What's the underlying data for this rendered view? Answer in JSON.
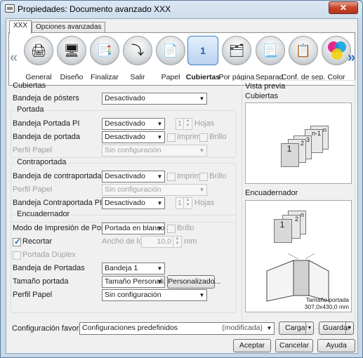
{
  "window": {
    "title": "Propiedades: Documento avanzado XXX",
    "close_label": "✕"
  },
  "tabs": [
    {
      "label": "XXX"
    },
    {
      "label": "Opciones avanzadas"
    }
  ],
  "toolbar": {
    "items": [
      {
        "label": "General",
        "icon": "printer-icon"
      },
      {
        "label": "Diseño",
        "icon": "layout-icon"
      },
      {
        "label": "Finalizar",
        "icon": "finishing-icon"
      },
      {
        "label": "Salir",
        "icon": "output-tray-icon"
      },
      {
        "label": "Papel",
        "icon": "paper-icon"
      },
      {
        "label": "Cubiertas",
        "icon": "cover-icon"
      },
      {
        "label": "Por página",
        "icon": "per-page-icon"
      },
      {
        "label": "Separad.",
        "icon": "separator-icon"
      },
      {
        "label": "Conf. de sep.",
        "icon": "separator-settings-icon"
      },
      {
        "label": "Color",
        "icon": "color-icon"
      }
    ],
    "active": "Cubiertas"
  },
  "cubiertas": {
    "section_label": "Cubiertas",
    "bandeja_posters_label": "Bandeja de pósters",
    "bandeja_posters_value": "Desactivado"
  },
  "portada": {
    "group_label": "Portada",
    "bandeja_pi_label": "Bandeja Portada PI",
    "bandeja_pi_value": "Desactivado",
    "bandeja_pi_spin": "1",
    "hojas_label": "Hojas",
    "bandeja_label": "Bandeja de portada",
    "bandeja_value": "Desactivado",
    "imprimir_label": "Imprimir",
    "brillo_label": "Brillo",
    "perfil_label": "Perfil Papel",
    "perfil_value": "Sin configuración"
  },
  "contraportada": {
    "group_label": "Contraportada",
    "bandeja_label": "Bandeja de contraportada",
    "bandeja_value": "Desactivado",
    "imprimir_label": "Imprimir",
    "brillo_label": "Brillo",
    "perfil_label": "Perfil Papel",
    "perfil_value": "Sin configuración",
    "bandeja_pi_label": "Bandeja Contraportada PI",
    "bandeja_pi_value": "Desactivado",
    "bandeja_pi_spin": "1",
    "hojas_label": "Hojas"
  },
  "encuadernador": {
    "group_label": "Encuadernador",
    "modo_label": "Modo de Impresión de Portada",
    "modo_value": "Portada en blanco",
    "brillo_label": "Brillo",
    "recortar_label": "Recortar",
    "recortar_checked": true,
    "ancho_lomo_label": "Ancho de lomo",
    "ancho_lomo_value": "10,0",
    "ancho_lomo_unit": "mm",
    "portada_duplex_label": "Portada Dúplex",
    "bandeja_portadas_label": "Bandeja de Portadas",
    "bandeja_portadas_value": "Bandeja 1",
    "tamano_label": "Tamaño portada",
    "tamano_value": "Tamaño Personalizad",
    "personalizado_label": "Personalizado...",
    "perfil_label": "Perfil Papel",
    "perfil_value": "Sin configuración"
  },
  "preview": {
    "title": "Vista previa",
    "cubiertas_label": "Cubiertas",
    "encuadernador_label": "Encuadernador",
    "sheet_labels": [
      "1",
      "2",
      "3",
      "n-1",
      "n"
    ],
    "binder_sheet_labels": [
      "1",
      "2",
      "n"
    ],
    "size_caption_line1": "Tamaño portada",
    "size_caption_line2": "307,0x430,0 mm"
  },
  "favorites": {
    "label": "Configuración favorita",
    "value": "Configuraciones predefinidos",
    "modified": "(modificada)",
    "load_label": "Cargar",
    "save_label": "Guardar"
  },
  "footer": {
    "accept_label": "Aceptar",
    "cancel_label": "Cancelar",
    "help_label": "Ayuda"
  }
}
